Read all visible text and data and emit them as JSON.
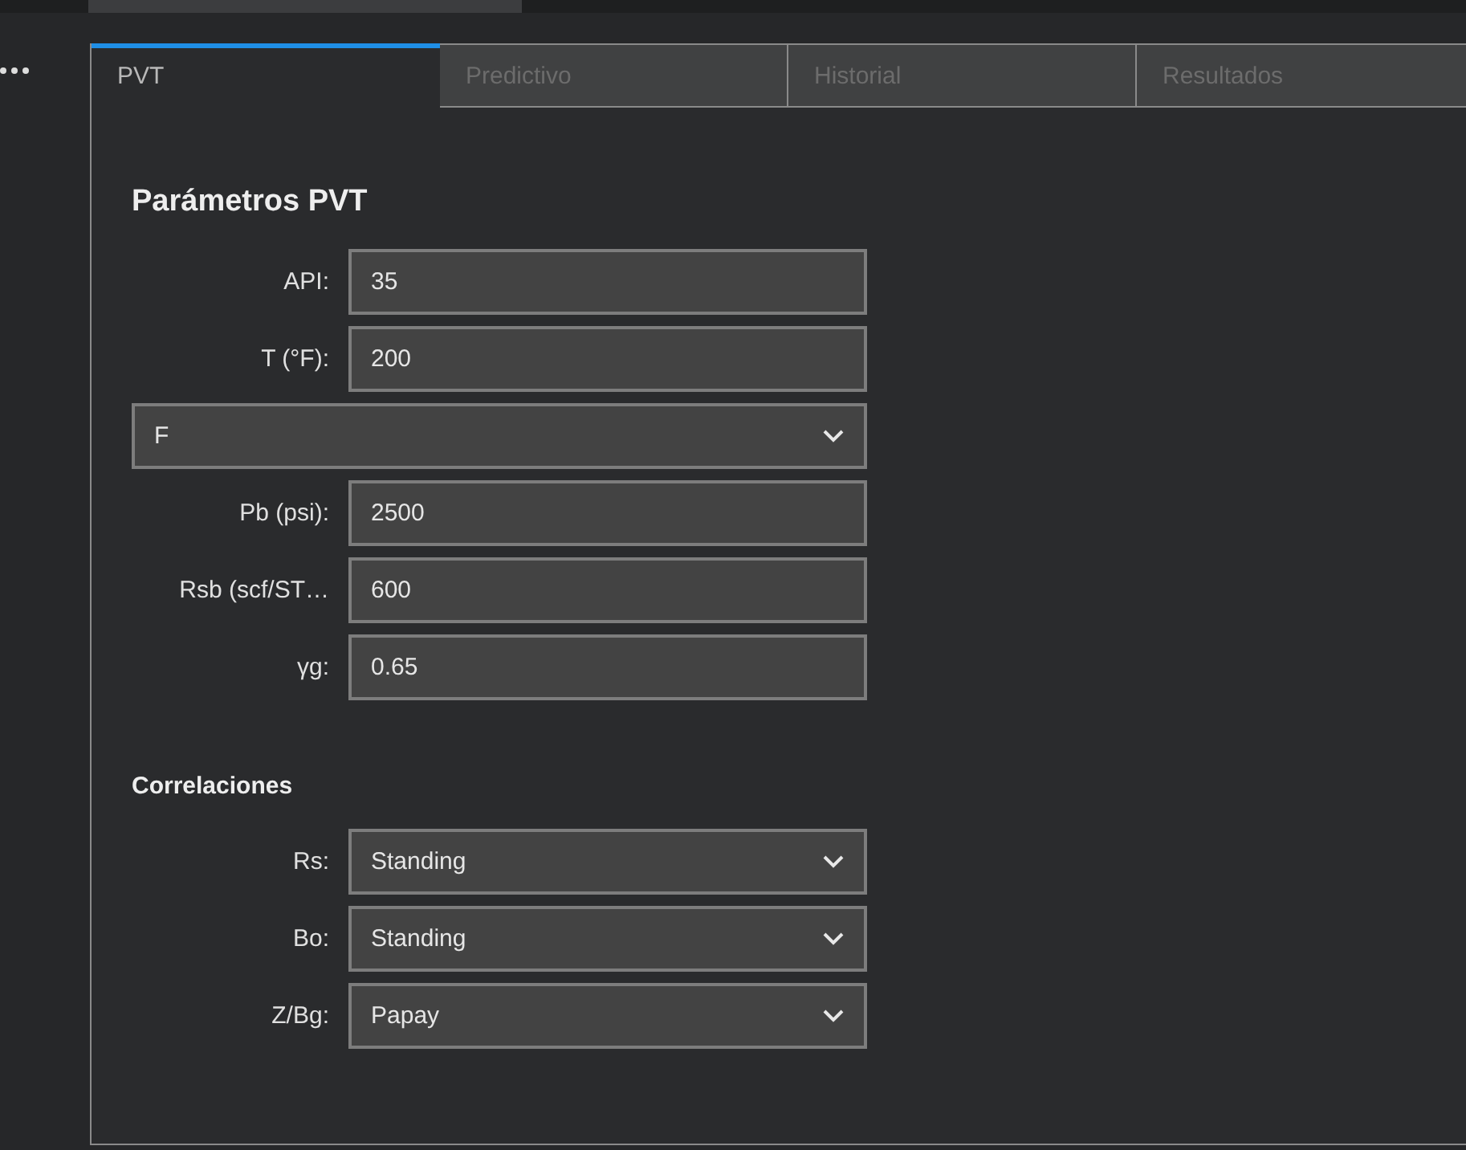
{
  "tabs": [
    {
      "label": "PVT",
      "selected": true
    },
    {
      "label": "Predictivo",
      "selected": false
    },
    {
      "label": "Historial",
      "selected": false
    },
    {
      "label": "Resultados",
      "selected": false
    }
  ],
  "parameters": {
    "title": "Parámetros PVT",
    "fields": [
      {
        "kind": "input",
        "label": "API:",
        "value": "35"
      },
      {
        "kind": "input",
        "label": "T (°F):",
        "value": "200"
      },
      {
        "kind": "select",
        "value": "F"
      },
      {
        "kind": "input",
        "label": "Pb (psi):",
        "value": "2500"
      },
      {
        "kind": "input",
        "label": "Rsb (scf/ST…",
        "value": "600"
      },
      {
        "kind": "input",
        "label": "γg:",
        "value": "0.65"
      }
    ]
  },
  "correlations": {
    "title": "Correlaciones",
    "fields": [
      {
        "kind": "select",
        "label": "Rs:",
        "value": "Standing"
      },
      {
        "kind": "select",
        "label": "Bo:",
        "value": "Standing"
      },
      {
        "kind": "select",
        "label": "Z/Bg:",
        "value": "Papay"
      }
    ]
  }
}
